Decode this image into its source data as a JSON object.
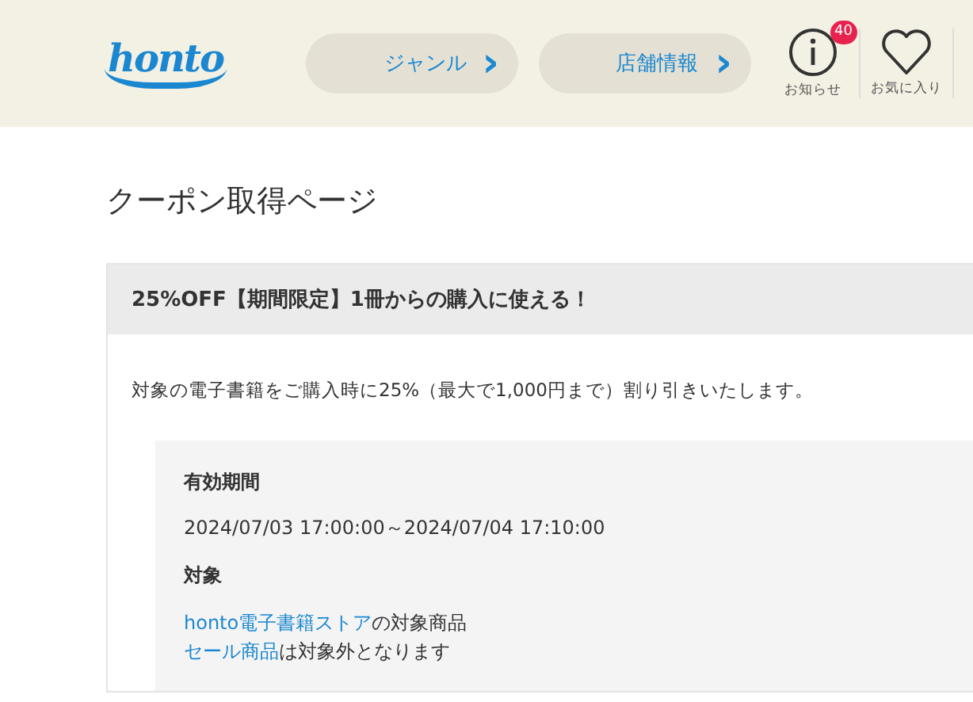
{
  "header": {
    "logo": "honto",
    "nav": [
      {
        "label": "ジャンル",
        "arrow": "›"
      },
      {
        "label": "店舗情報",
        "arrow": "›"
      }
    ],
    "icons": [
      {
        "kind": "info",
        "label": "お知らせ",
        "badge": "40"
      },
      {
        "kind": "heart",
        "label": "お気に入り"
      }
    ]
  },
  "page_title": "クーポン取得ページ",
  "coupon": {
    "title": "25%OFF【期間限定】1冊からの購入に使える！",
    "description": "対象の電子書籍をご購入時に25%（最大で1,000円まで）割り引きいたします。",
    "details": [
      {
        "kind": "heading",
        "text": "有効期間"
      },
      {
        "kind": "text",
        "text": "2024/07/03 17:00:00～2024/07/04 17:10:00"
      },
      {
        "kind": "heading",
        "text": "対象"
      },
      {
        "kind": "link_line",
        "link": "honto電子書籍ストア",
        "rest": "の対象商品"
      },
      {
        "kind": "link_line",
        "link": "セール商品",
        "rest": "は対象外となります"
      }
    ]
  }
}
